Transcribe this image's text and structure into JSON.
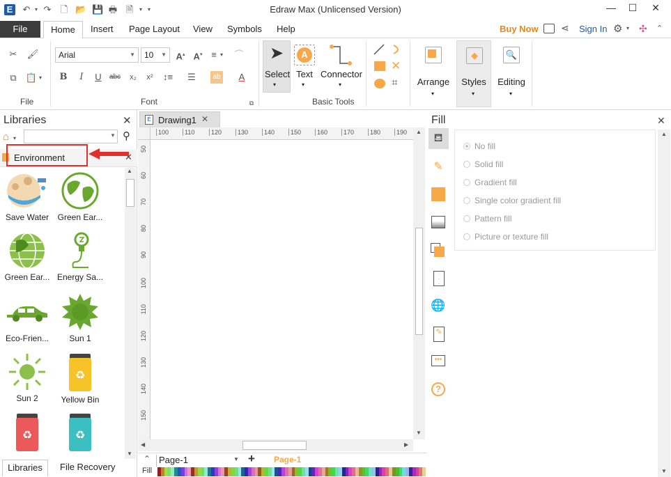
{
  "window": {
    "title": "Edraw Max (Unlicensed Version)"
  },
  "menu": {
    "file": "File",
    "items": [
      "Home",
      "Insert",
      "Page Layout",
      "View",
      "Symbols",
      "Help"
    ],
    "buy_now": "Buy Now",
    "sign_in": "Sign In"
  },
  "ribbon": {
    "font_name": "Arial",
    "font_size": "10",
    "groups": {
      "file": "File",
      "font": "Font",
      "basic_tools": "Basic Tools"
    },
    "tools": {
      "select": "Select",
      "text": "Text",
      "connector": "Connector"
    },
    "right_buttons": {
      "arrange": "Arrange",
      "styles": "Styles",
      "editing": "Editing"
    }
  },
  "libraries": {
    "title": "Libraries",
    "search_placeholder": "",
    "category": "Environment",
    "items": [
      {
        "label": "Save Water",
        "icon": "save-water-icon"
      },
      {
        "label": "Green Ear...",
        "icon": "green-earth-icon"
      },
      {
        "label": "Green Ear...",
        "icon": "green-earth-grid-icon"
      },
      {
        "label": "Energy Sa...",
        "icon": "energy-saving-bulb-icon"
      },
      {
        "label": "Eco-Frien...",
        "icon": "eco-car-icon"
      },
      {
        "label": "Sun 1",
        "icon": "sun-1-icon"
      },
      {
        "label": "Sun 2",
        "icon": "sun-2-icon"
      },
      {
        "label": "Yellow Bin",
        "icon": "yellow-bin-icon"
      },
      {
        "label": "",
        "icon": "red-bin-icon"
      },
      {
        "label": "",
        "icon": "teal-bin-icon"
      }
    ],
    "bottom_tabs": [
      "Libraries",
      "File Recovery"
    ]
  },
  "document": {
    "tab": "Drawing1",
    "ruler_h": [
      "100",
      "110",
      "120",
      "130",
      "140",
      "150",
      "160",
      "170",
      "180",
      "190"
    ],
    "ruler_v": [
      "50",
      "60",
      "70",
      "80",
      "90",
      "100",
      "110",
      "120",
      "130",
      "140",
      "150"
    ],
    "page_selector": "Page-1",
    "active_page": "Page-1",
    "fill_label": "Fill"
  },
  "fill_panel": {
    "title": "Fill",
    "options": [
      "No fill",
      "Solid fill",
      "Gradient fill",
      "Single color gradient fill",
      "Pattern fill",
      "Picture or texture fill"
    ],
    "selected": "No fill"
  },
  "colors": {
    "accent_orange": "#f7a94a",
    "brand_orange": "#e08a1b",
    "green": "#6aa72f",
    "highlight_red": "#e0302e",
    "file_menu": "#3c3c3c"
  }
}
